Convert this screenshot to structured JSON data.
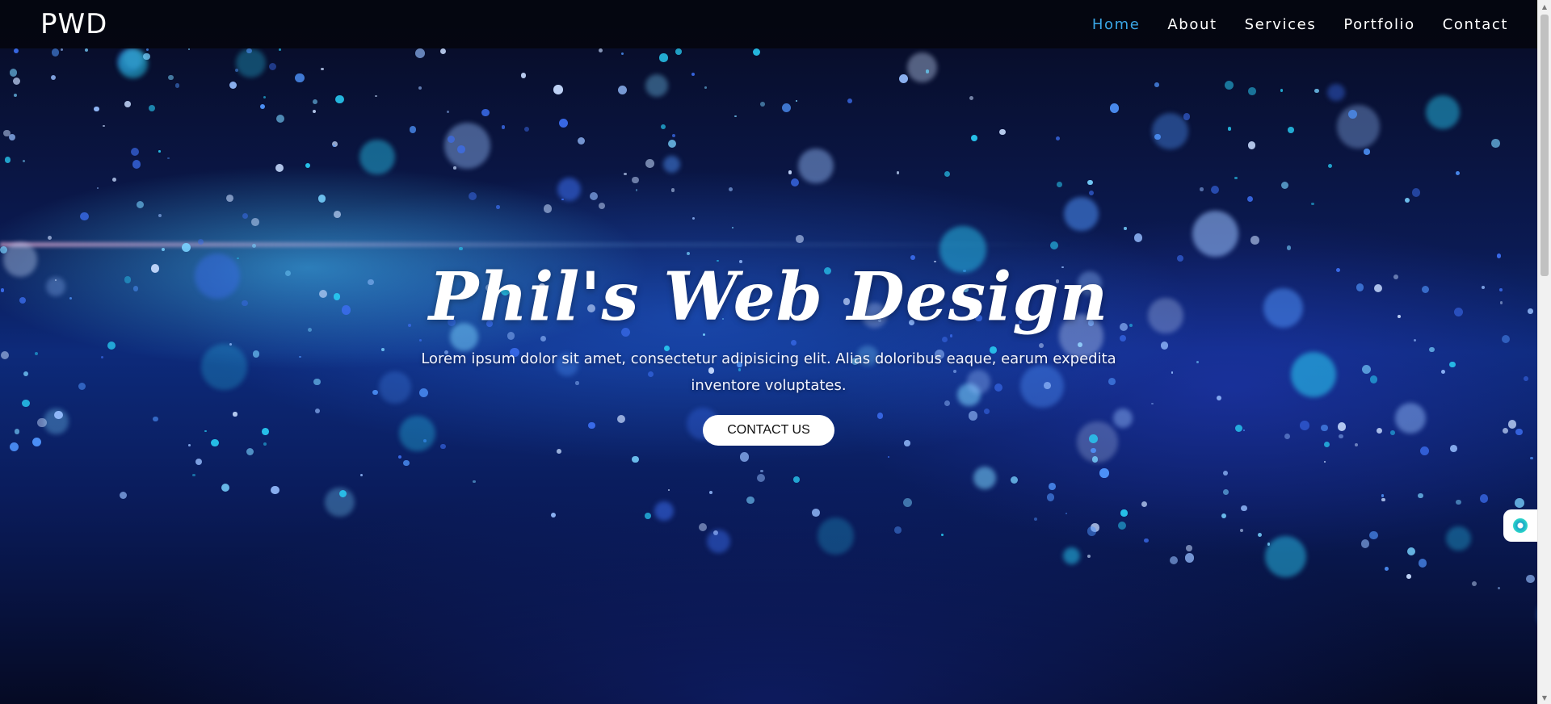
{
  "header": {
    "logo": "PWD",
    "nav": [
      {
        "label": "Home",
        "active": true
      },
      {
        "label": "About",
        "active": false
      },
      {
        "label": "Services",
        "active": false
      },
      {
        "label": "Portfolio",
        "active": false
      },
      {
        "label": "Contact",
        "active": false
      }
    ]
  },
  "hero": {
    "title": "Phil's Web Design",
    "subtitle": "Lorem ipsum dolor sit amet, consectetur adipisicing elit. Alias doloribus eaque, earum expedita inventore voluptates.",
    "cta_label": "CONTACT US"
  },
  "widgets": {
    "floating_icon": "chat-widget-icon"
  },
  "colors": {
    "nav_active": "#3aa6e6",
    "header_bg": "#04060e",
    "accent_blue": "#1e4fd8"
  }
}
